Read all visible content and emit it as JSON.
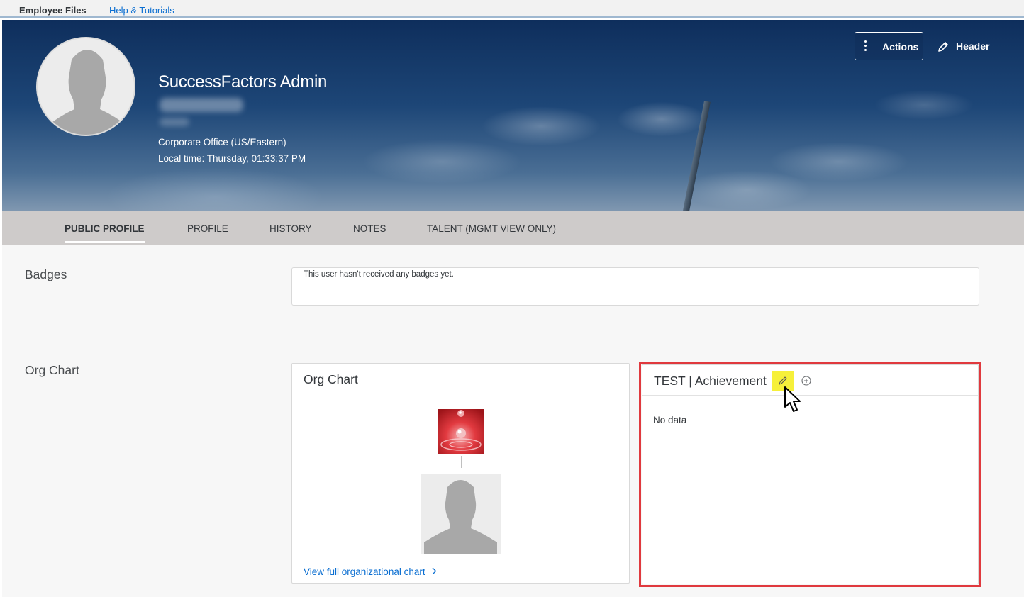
{
  "topbar": {
    "app_title": "Employee Files",
    "help_link": "Help & Tutorials"
  },
  "header": {
    "employee_name": "SuccessFactors Admin",
    "location": "Corporate Office (US/Eastern)",
    "local_time": "Local time: Thursday, 01:33:37 PM",
    "actions_label": "Actions",
    "header_label": "Header"
  },
  "tabs": [
    {
      "label": "PUBLIC PROFILE",
      "active": true
    },
    {
      "label": "PROFILE",
      "active": false
    },
    {
      "label": "HISTORY",
      "active": false
    },
    {
      "label": "NOTES",
      "active": false
    },
    {
      "label": "TALENT (MGMT VIEW ONLY)",
      "active": false
    }
  ],
  "sections": {
    "badges": {
      "label": "Badges",
      "message": "This user hasn't received any badges yet."
    },
    "org_chart": {
      "label": "Org Chart",
      "card_title": "Org Chart",
      "link": "View full organizational chart"
    },
    "achievement": {
      "title": "TEST | Achievement",
      "empty_text": "No data"
    }
  },
  "icons": {
    "actions": "vertical-dots-icon",
    "header": "pencil-icon",
    "edit": "pencil-icon",
    "add": "plus-circle-icon",
    "link_chevron": "chevron-right-icon"
  },
  "colors": {
    "accent": "#0a6ed1",
    "highlight": "#e0393e",
    "edit_highlight": "#f6f03a",
    "tab_bar": "#cecbca"
  }
}
